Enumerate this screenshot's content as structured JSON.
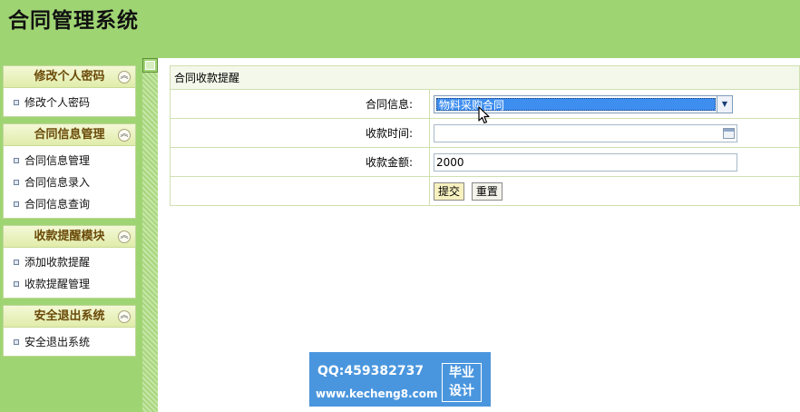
{
  "header": {
    "title": "合同管理系统"
  },
  "sidebar": {
    "panels": [
      {
        "title": "修改个人密码",
        "items": [
          "修改个人密码"
        ]
      },
      {
        "title": "合同信息管理",
        "items": [
          "合同信息管理",
          "合同信息录入",
          "合同信息查询"
        ]
      },
      {
        "title": "收款提醒模块",
        "items": [
          "添加收款提醒",
          "收款提醒管理"
        ]
      },
      {
        "title": "安全退出系统",
        "items": [
          "安全退出系统"
        ]
      }
    ],
    "collapse_glyph": "︽"
  },
  "form": {
    "caption": "合同收款提醒",
    "contract_label": "合同信息:",
    "contract_value": "物料采购合同",
    "time_label": "收款时间:",
    "time_value": "",
    "amount_label": "收款金额:",
    "amount_value": "2000",
    "submit_label": "提交",
    "reset_label": "重置"
  },
  "watermark": {
    "qq": "QQ:459382737",
    "site": "www.kecheng8.com",
    "badge_line1": "毕业",
    "badge_line2": "设计"
  },
  "colors": {
    "header_bg": "#9fd473",
    "panel_title": "#6a4a08",
    "selection": "#3e8ef0",
    "watermark_bg": "#4a96de"
  },
  "icons": [
    "collapse-up-icon",
    "bullet-icon",
    "dropdown-arrow-icon",
    "calendar-icon",
    "mouse-cursor-icon",
    "sidebar-toggle-icon"
  ]
}
